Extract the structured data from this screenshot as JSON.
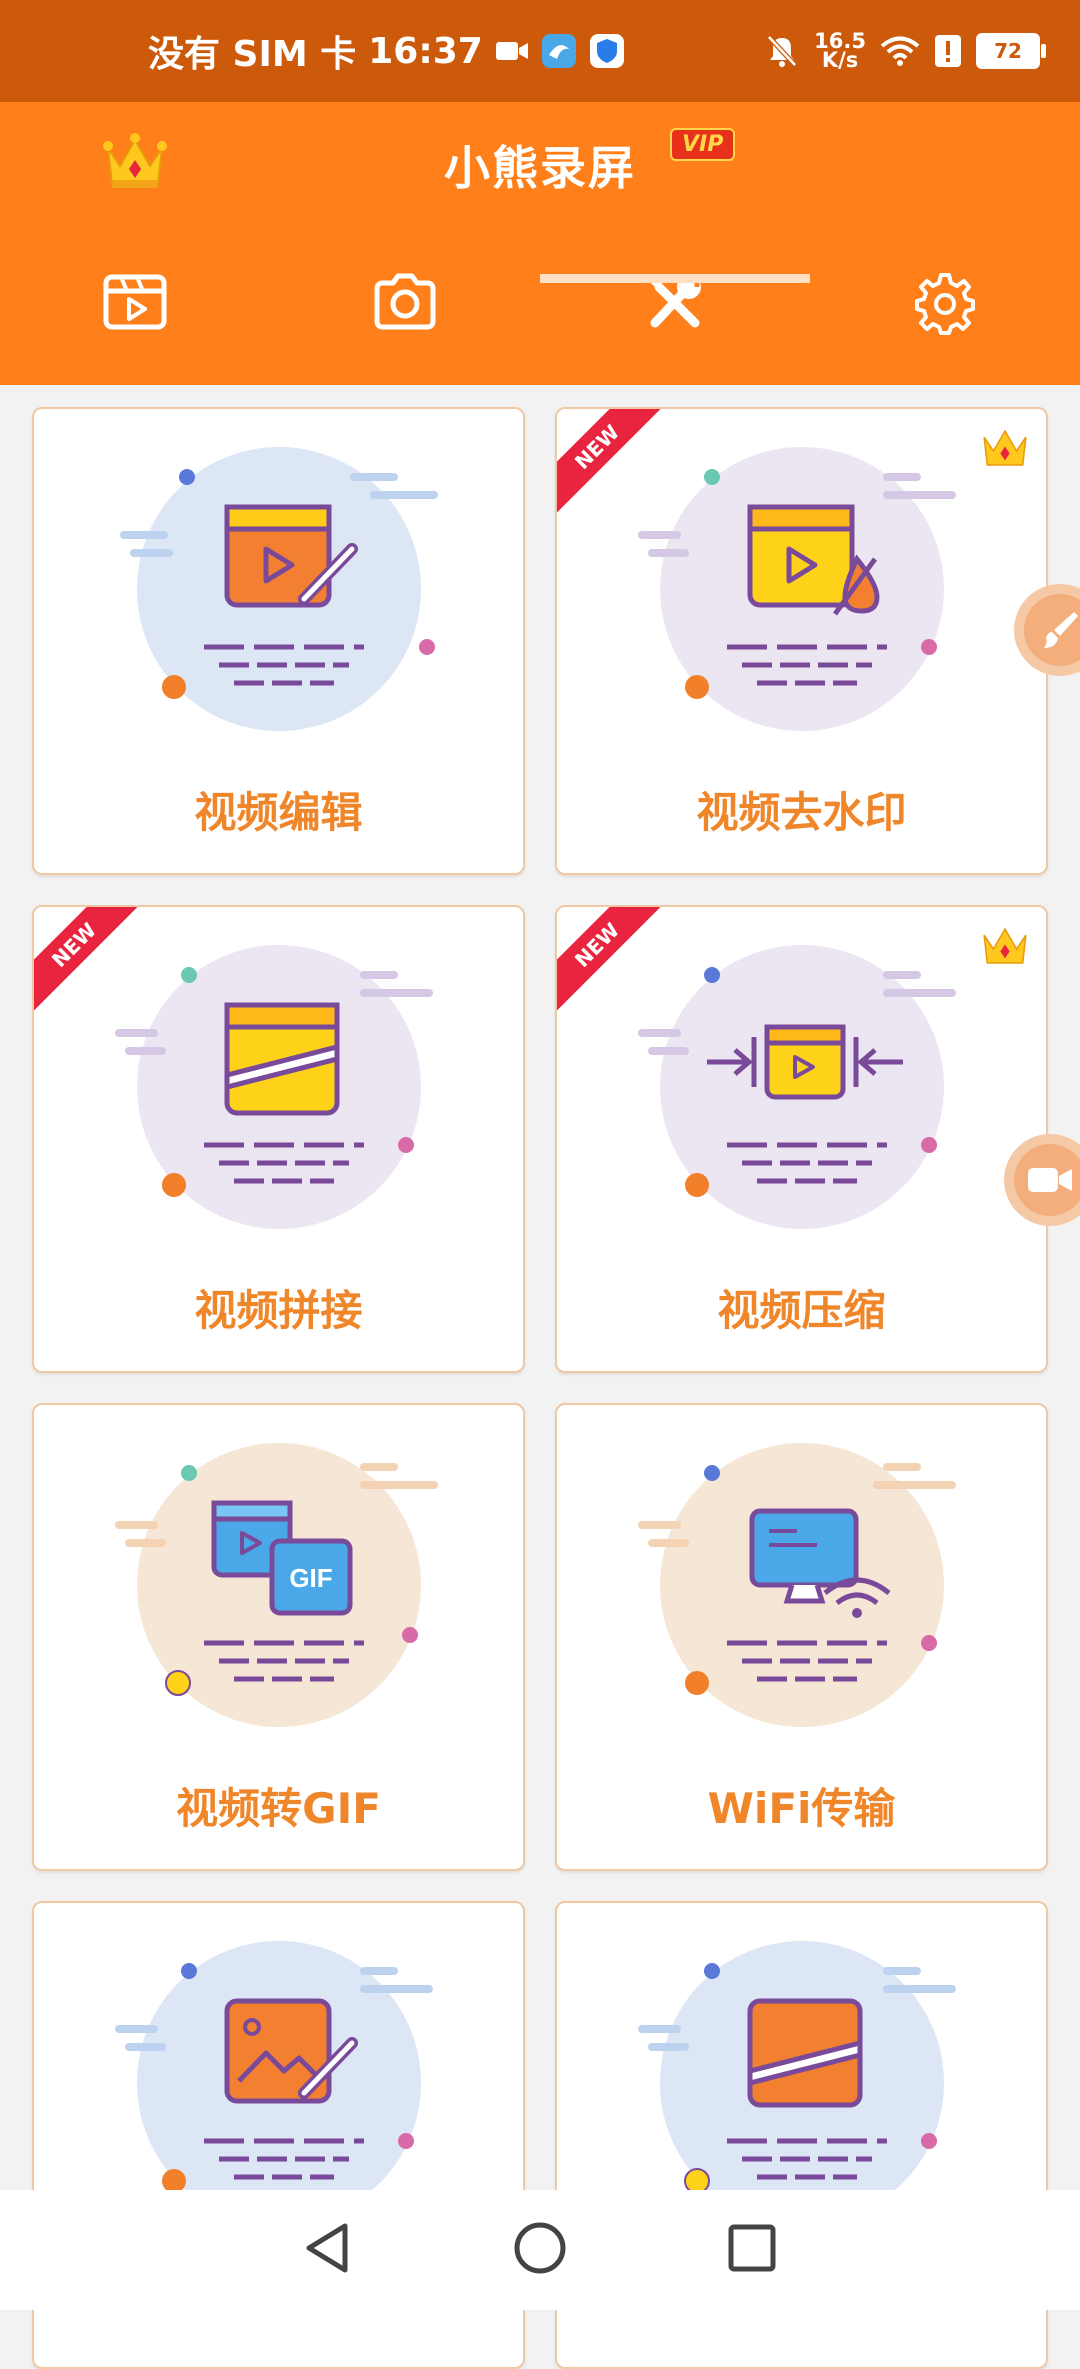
{
  "status_bar": {
    "carrier": "没有 SIM 卡",
    "time": "16:37",
    "net_speed_value": "16.5",
    "net_speed_unit": "K/s",
    "battery": "72"
  },
  "header": {
    "title": "小熊录屏",
    "vip_badge": "VIP"
  },
  "tabs": [
    {
      "name": "video-list",
      "icon": "film-icon"
    },
    {
      "name": "screenshot",
      "icon": "camera-icon"
    },
    {
      "name": "tools",
      "icon": "tools-icon",
      "selected": true
    },
    {
      "name": "settings",
      "icon": "gear-icon"
    }
  ],
  "tools": [
    {
      "label": "视频编辑",
      "new": false,
      "vip": false,
      "circle_color": "#dde6f5",
      "icon": "video-edit-icon"
    },
    {
      "label": "视频去水印",
      "new": true,
      "vip": true,
      "circle_color": "#ece6f3",
      "icon": "watermark-remove-icon",
      "ribbon": "NEW"
    },
    {
      "label": "视频拼接",
      "new": true,
      "vip": false,
      "circle_color": "#ece6f3",
      "icon": "video-merge-icon",
      "ribbon": "NEW"
    },
    {
      "label": "视频压缩",
      "new": true,
      "vip": true,
      "circle_color": "#ece6f3",
      "icon": "video-compress-icon",
      "ribbon": "NEW"
    },
    {
      "label": "视频转GIF",
      "new": false,
      "vip": false,
      "circle_color": "#f6e6d6",
      "icon": "video-to-gif-icon"
    },
    {
      "label": "WiFi传输",
      "new": false,
      "vip": false,
      "circle_color": "#f6e6d6",
      "icon": "wifi-transfer-icon"
    },
    {
      "label": "",
      "new": false,
      "vip": false,
      "circle_color": "#dde6f5",
      "icon": "image-edit-icon"
    },
    {
      "label": "",
      "new": false,
      "vip": false,
      "circle_color": "#dde6f5",
      "icon": "video-crop-icon"
    }
  ],
  "gif_text": "GIF",
  "colors": {
    "status_bar": "#cc5a0a",
    "header": "#ff801a",
    "label": "#f0862a",
    "ribbon": "#e8243e",
    "purple": "#7a4a9a"
  }
}
